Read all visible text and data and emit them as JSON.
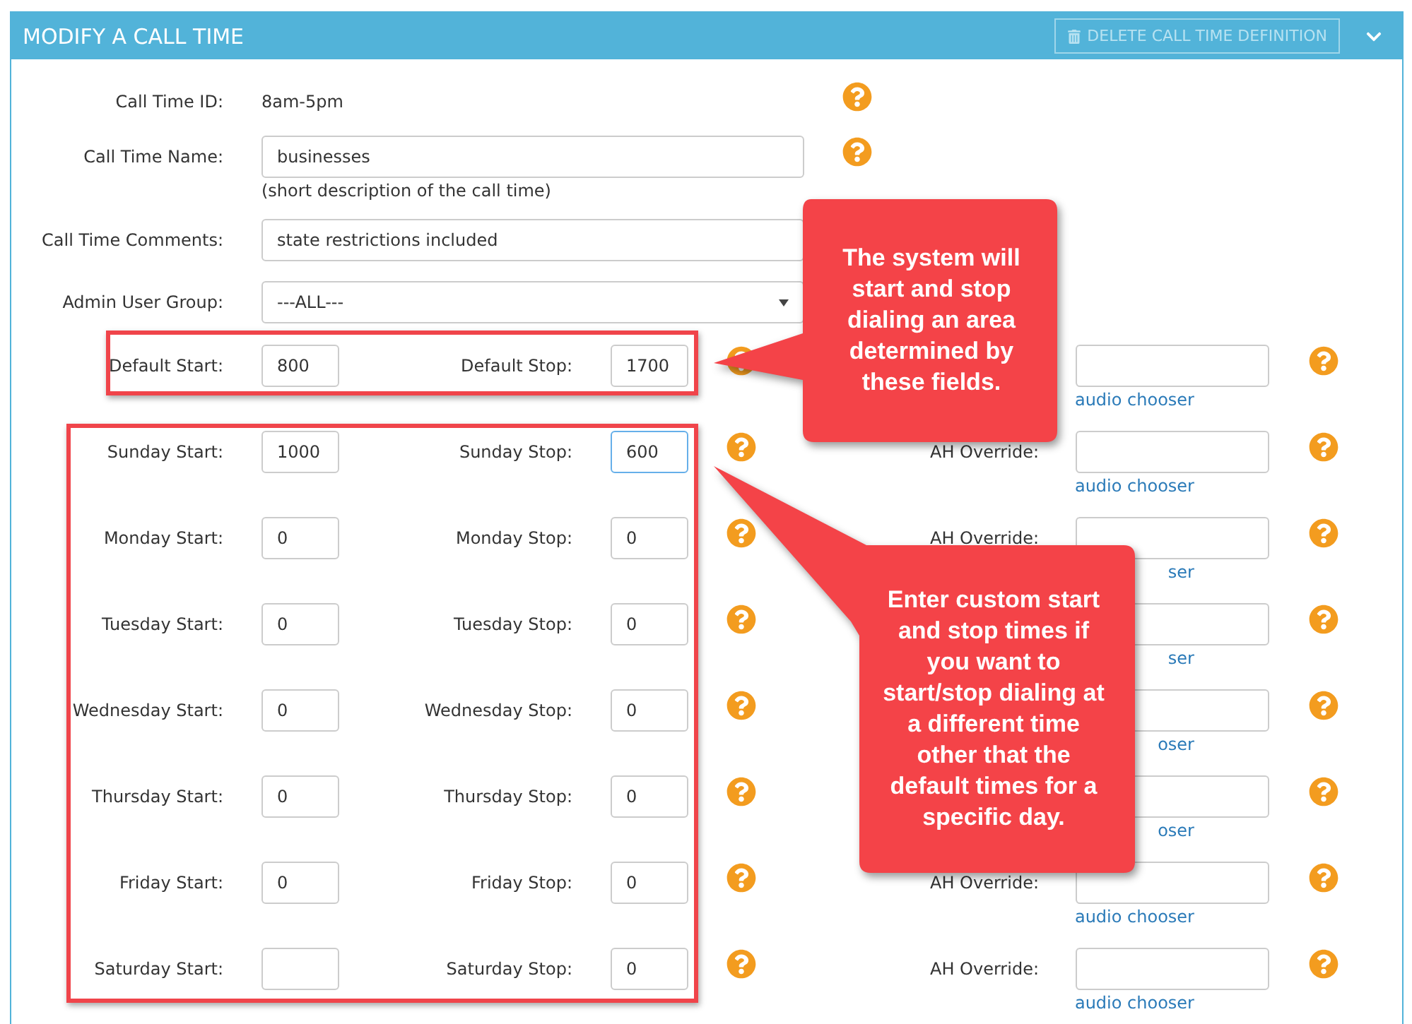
{
  "panel": {
    "title": "MODIFY A CALL TIME",
    "delete_button": "DELETE CALL TIME DEFINITION"
  },
  "fields": [
    {
      "kind": "text",
      "label": "Call Time ID:",
      "value": "8am-5pm",
      "help": true
    },
    {
      "kind": "input",
      "label": "Call Time Name:",
      "value": "businesses",
      "hint": "(short description of the call time)",
      "help": true
    },
    {
      "kind": "input",
      "label": "Call Time Comments:",
      "value": "state restrictions included",
      "help": false
    },
    {
      "kind": "select",
      "label": "Admin User Group:",
      "value": "---ALL---",
      "help": false
    }
  ],
  "schedule": [
    {
      "start_label": "Default Start:",
      "start": "800",
      "stop_label": "Default Stop:",
      "stop": "1700",
      "stop_focused": false,
      "chooser": "audio chooser"
    },
    {
      "start_label": "Sunday Start:",
      "start": "1000",
      "stop_label": "Sunday Stop:",
      "stop": "600",
      "stop_focused": true,
      "ah_label": "AH Override:",
      "chooser": "audio chooser"
    },
    {
      "start_label": "Monday Start:",
      "start": "0",
      "stop_label": "Monday Stop:",
      "stop": "0",
      "stop_focused": false,
      "ah_label": "AH Override:",
      "chooser": "ser"
    },
    {
      "start_label": "Tuesday Start:",
      "start": "0",
      "stop_label": "Tuesday Stop:",
      "stop": "0",
      "stop_focused": false,
      "chooser": "ser"
    },
    {
      "start_label": "Wednesday Start:",
      "start": "0",
      "stop_label": "Wednesday Stop:",
      "stop": "0",
      "stop_focused": false,
      "chooser": "oser"
    },
    {
      "start_label": "Thursday Start:",
      "start": "0",
      "stop_label": "Thursday Stop:",
      "stop": "0",
      "stop_focused": false,
      "chooser": "oser"
    },
    {
      "start_label": "Friday Start:",
      "start": "0",
      "stop_label": "Friday Stop:",
      "stop": "0",
      "stop_focused": false,
      "ah_label": "AH Override:",
      "chooser": "audio chooser"
    },
    {
      "start_label": "Saturday Start:",
      "stop_label": "Saturday Stop:",
      "stop": "0",
      "stop_focused": false,
      "ah_label": "AH Override:",
      "chooser": "audio chooser"
    }
  ],
  "callouts": [
    {
      "text": "The system will start and stop dialing an area determined by these fields."
    },
    {
      "text": "Enter custom start and stop times if you want to start/stop dialing at a different time other that the default times for a specific day."
    }
  ]
}
